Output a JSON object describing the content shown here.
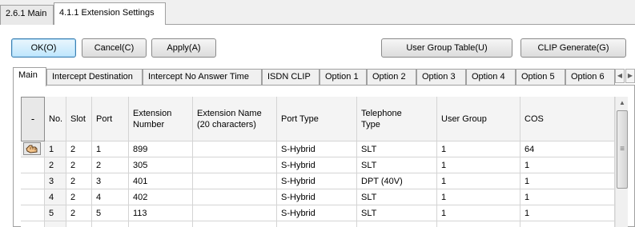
{
  "window_tabs": [
    {
      "label": "2.6.1 Main"
    },
    {
      "label": "4.1.1 Extension Settings"
    }
  ],
  "buttons": {
    "ok": "OK(O)",
    "cancel": "Cancel(C)",
    "apply": "Apply(A)",
    "user_group_table": "User Group Table(U)",
    "clip_generate": "CLIP Generate(G)"
  },
  "sub_tabs": [
    {
      "label": "Main"
    },
    {
      "label": "Intercept Destination"
    },
    {
      "label": "Intercept No Answer Time"
    },
    {
      "label": "ISDN CLIP"
    },
    {
      "label": "Option 1"
    },
    {
      "label": "Option 2"
    },
    {
      "label": "Option 3"
    },
    {
      "label": "Option 4"
    },
    {
      "label": "Option 5"
    },
    {
      "label": "Option 6"
    }
  ],
  "table": {
    "select_header": "-",
    "headers": {
      "no": "No.",
      "slot": "Slot",
      "port": "Port",
      "ext_line1": "Extension",
      "ext_line2": "Number",
      "name_line1": "Extension Name",
      "name_line2": "(20 characters)",
      "port_type": "Port Type",
      "tel_line1": "Telephone",
      "tel_line2": "Type",
      "user_group": "User Group",
      "cos": "COS"
    },
    "rows": [
      {
        "no": "1",
        "slot": "2",
        "port": "1",
        "ext": "899",
        "name": "",
        "port_type": "S-Hybrid",
        "tel_type": "SLT",
        "user_group": "1",
        "cos": "64"
      },
      {
        "no": "2",
        "slot": "2",
        "port": "2",
        "ext": "305",
        "name": "",
        "port_type": "S-Hybrid",
        "tel_type": "SLT",
        "user_group": "1",
        "cos": "1"
      },
      {
        "no": "3",
        "slot": "2",
        "port": "3",
        "ext": "401",
        "name": "",
        "port_type": "S-Hybrid",
        "tel_type": "DPT (40V)",
        "user_group": "1",
        "cos": "1"
      },
      {
        "no": "4",
        "slot": "2",
        "port": "4",
        "ext": "402",
        "name": "",
        "port_type": "S-Hybrid",
        "tel_type": "SLT",
        "user_group": "1",
        "cos": "1"
      },
      {
        "no": "5",
        "slot": "2",
        "port": "5",
        "ext": "113",
        "name": "",
        "port_type": "S-Hybrid",
        "tel_type": "SLT",
        "user_group": "1",
        "cos": "1"
      }
    ]
  },
  "icons": {
    "row_pointer": "hand-pointer-icon",
    "scroll_left": "arrow-left-icon",
    "scroll_right": "arrow-right-icon",
    "scroll_up": "arrow-up-icon"
  },
  "colors": {
    "primary_button_border": "#3c7fb1",
    "header_background": "#f4f4f4",
    "grid_lines": "#d4d4d4"
  }
}
